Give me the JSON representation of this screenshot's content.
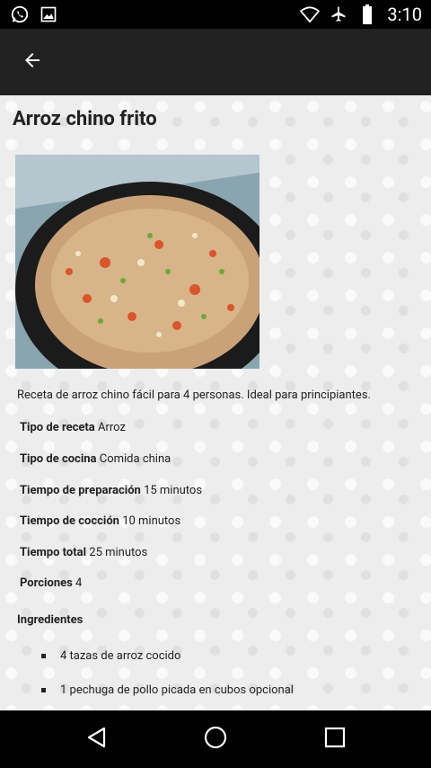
{
  "status_bar": {
    "left_icons": [
      "whatsapp-icon",
      "image-icon"
    ],
    "right_icons": [
      "wifi-icon",
      "airplane-icon",
      "battery-icon"
    ],
    "time": "3:10"
  },
  "app_bar": {
    "back_icon": "arrow-back-icon"
  },
  "recipe": {
    "title": "Arroz chino frito",
    "description": "Receta de arroz chino fácil para 4 personas. Ideal para principiantes.",
    "info": [
      {
        "label": "Tipo de receta",
        "value": "Arroz"
      },
      {
        "label": "Tipo de cocina",
        "value": "Comida china"
      },
      {
        "label": "Tiempo de preparación",
        "value": "15 minutos"
      },
      {
        "label": "Tiempo de cocción",
        "value": "10 minutos"
      },
      {
        "label": "Tiempo total",
        "value": "25 minutos"
      },
      {
        "label": "Porciones",
        "value": "4"
      }
    ],
    "ingredients_heading": "Ingredientes",
    "ingredients": [
      "4 tazas de arroz cocido",
      "1 pechuga de pollo picada en cubos opcional"
    ]
  },
  "nav_bar": {
    "icons": [
      "back-triangle-icon",
      "home-circle-icon",
      "recents-square-icon"
    ]
  }
}
